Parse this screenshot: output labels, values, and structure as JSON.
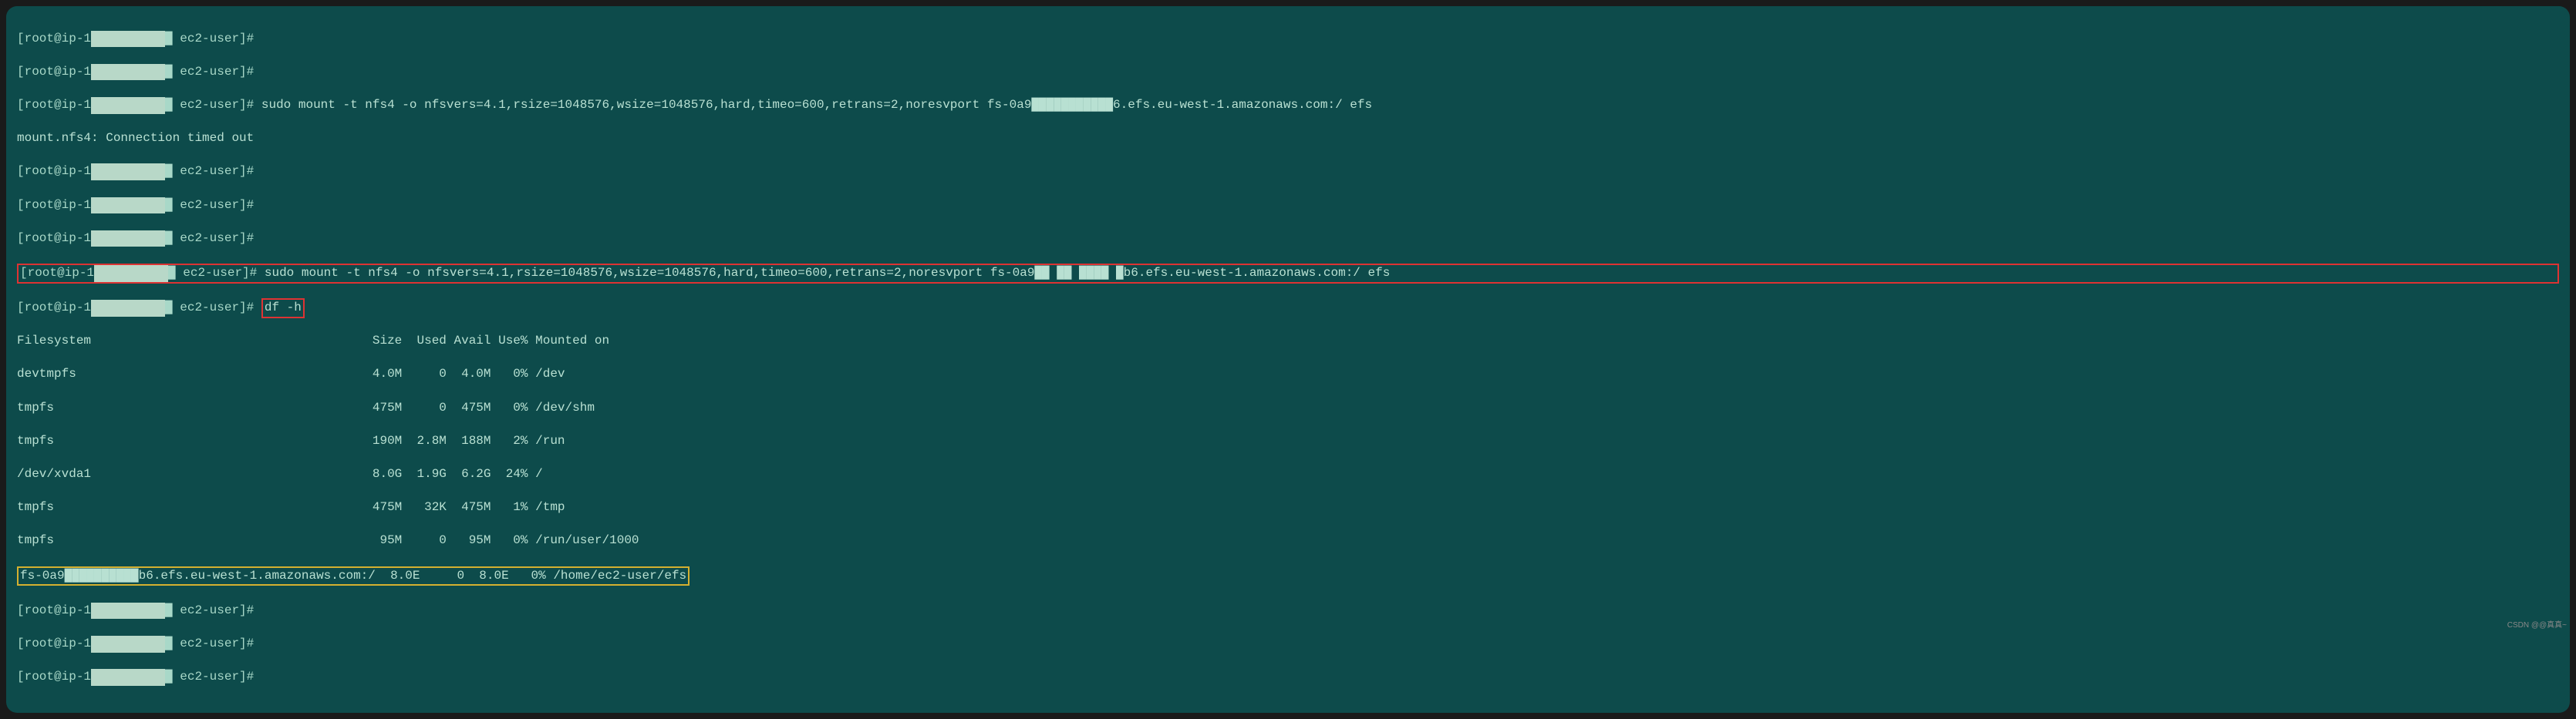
{
  "colors": {
    "terminal_bg": "#0d4b4b",
    "terminal_fg": "#b8e0d2",
    "highlight_red": "#d33",
    "highlight_yellow": "#d4b030"
  },
  "prompt": {
    "prefix": "[root@ip-1",
    "obscured": "██ ██ █ ██",
    "suffix": "█ ec2-user]#"
  },
  "lines": [
    {
      "type": "prompt",
      "cmd": ""
    },
    {
      "type": "prompt",
      "cmd": ""
    },
    {
      "type": "prompt",
      "cmd": "sudo mount -t nfs4 -o nfsvers=4.1,rsize=1048576,wsize=1048576,hard,timeo=600,retrans=2,noresvport fs-0a9███████████6.efs.eu-west-1.amazonaws.com:/ efs"
    },
    {
      "type": "output",
      "text": "mount.nfs4: Connection timed out"
    },
    {
      "type": "prompt",
      "cmd": ""
    },
    {
      "type": "prompt",
      "cmd": ""
    },
    {
      "type": "prompt",
      "cmd": ""
    },
    {
      "type": "prompt-highlight",
      "cmd": "sudo mount -t nfs4 -o nfsvers=4.1,rsize=1048576,wsize=1048576,hard,timeo=600,retrans=2,noresvport fs-0a9██ ██ ████ █b6.efs.eu-west-1.amazonaws.com:/ efs"
    },
    {
      "type": "prompt-df",
      "cmd": "df -h"
    }
  ],
  "df": {
    "header": "Filesystem                                      Size  Used Avail Use% Mounted on",
    "rows": [
      "devtmpfs                                        4.0M     0  4.0M   0% /dev",
      "tmpfs                                           475M     0  475M   0% /dev/shm",
      "tmpfs                                           190M  2.8M  188M   2% /run",
      "/dev/xvda1                                      8.0G  1.9G  6.2G  24% /",
      "tmpfs                                           475M   32K  475M   1% /tmp",
      "tmpfs                                            95M     0   95M   0% /run/user/1000"
    ],
    "highlighted_row": "fs-0a9██████████b6.efs.eu-west-1.amazonaws.com:/  8.0E     0  8.0E   0% /home/ec2-user/efs"
  },
  "trailing_prompts": [
    "",
    "",
    ""
  ],
  "watermark": "CSDN @@真真~"
}
